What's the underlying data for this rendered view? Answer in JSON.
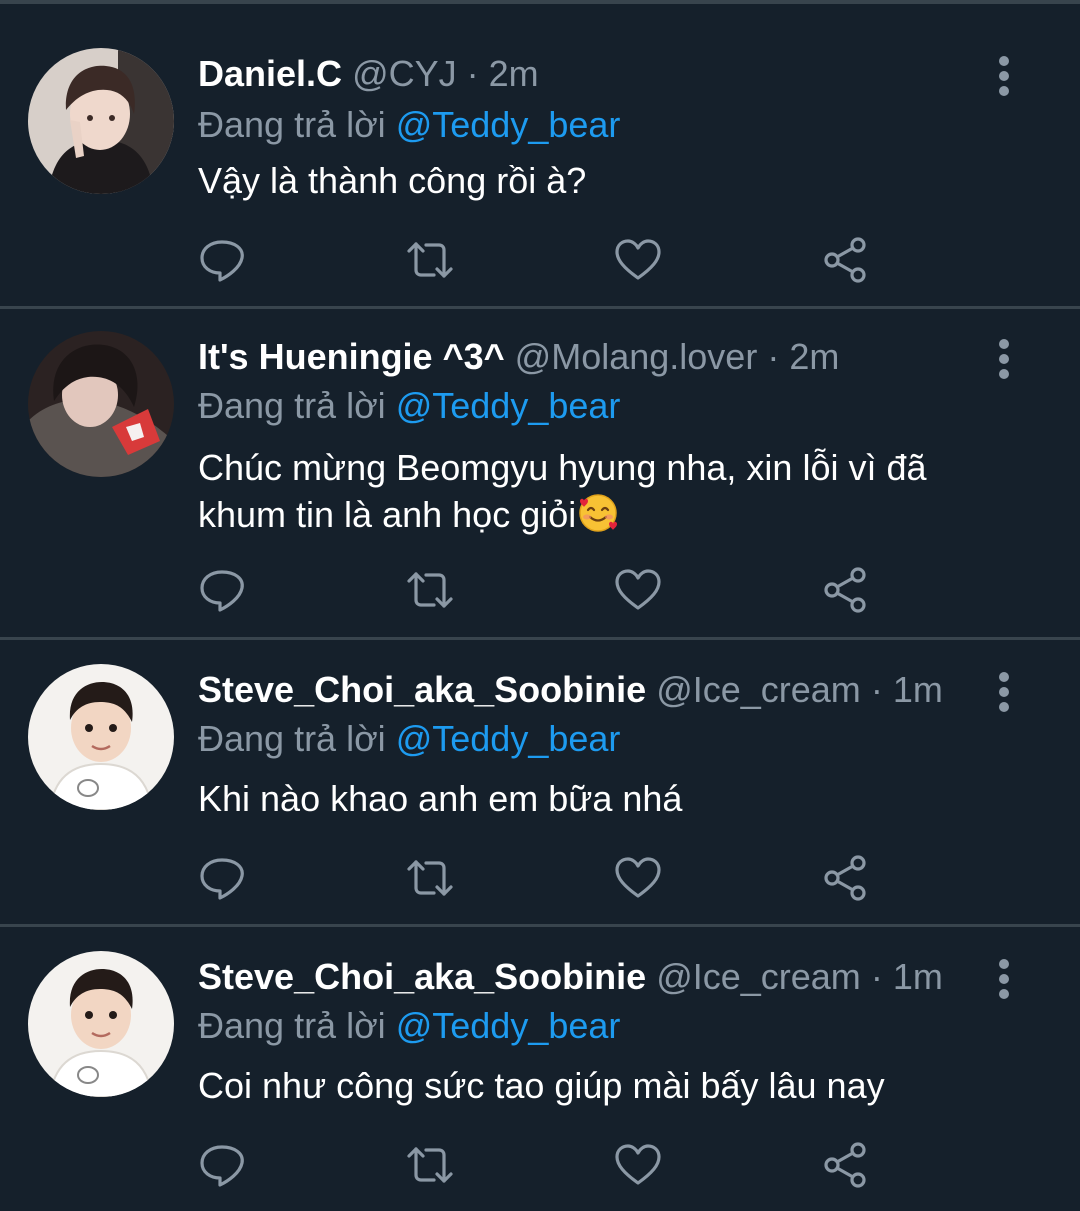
{
  "theme": {
    "background": "#15202b",
    "divider": "#38444d",
    "muted": "#8b98a5",
    "link": "#1d9bf0"
  },
  "tweets": [
    {
      "name": "Daniel.C",
      "handle": "@CYJ",
      "sep": "·",
      "time": "2m",
      "reply_prefix": "Đang trả lời",
      "reply_to": "@Teddy_bear",
      "text": "Vậy là thành công rồi à?",
      "emoji": ""
    },
    {
      "name": "It's Hueningie ^3^",
      "handle": "@Molang.lover",
      "sep": "·",
      "time": "2m",
      "reply_prefix": "Đang trả lời",
      "reply_to": "@Teddy_bear",
      "text": "Chúc mừng Beomgyu hyung nha, xin lỗi vì đã khum tin là anh học giỏi",
      "emoji": "smiling-face-with-hearts"
    },
    {
      "name": "Steve_Choi_aka_Soobinie",
      "handle": "@Ice_cream",
      "sep": "·",
      "time": "1m",
      "reply_prefix": "Đang trả lời",
      "reply_to": "@Teddy_bear",
      "text": "Khi nào khao anh em bữa nhá",
      "emoji": ""
    },
    {
      "name": "Steve_Choi_aka_Soobinie",
      "handle": "@Ice_cream",
      "sep": "·",
      "time": "1m",
      "reply_prefix": "Đang trả lời",
      "reply_to": "@Teddy_bear",
      "text": "Coi như công sức tao giúp mài bấy lâu nay",
      "emoji": ""
    }
  ],
  "icons": [
    "reply-icon",
    "retweet-icon",
    "like-icon",
    "share-icon",
    "more-icon"
  ]
}
